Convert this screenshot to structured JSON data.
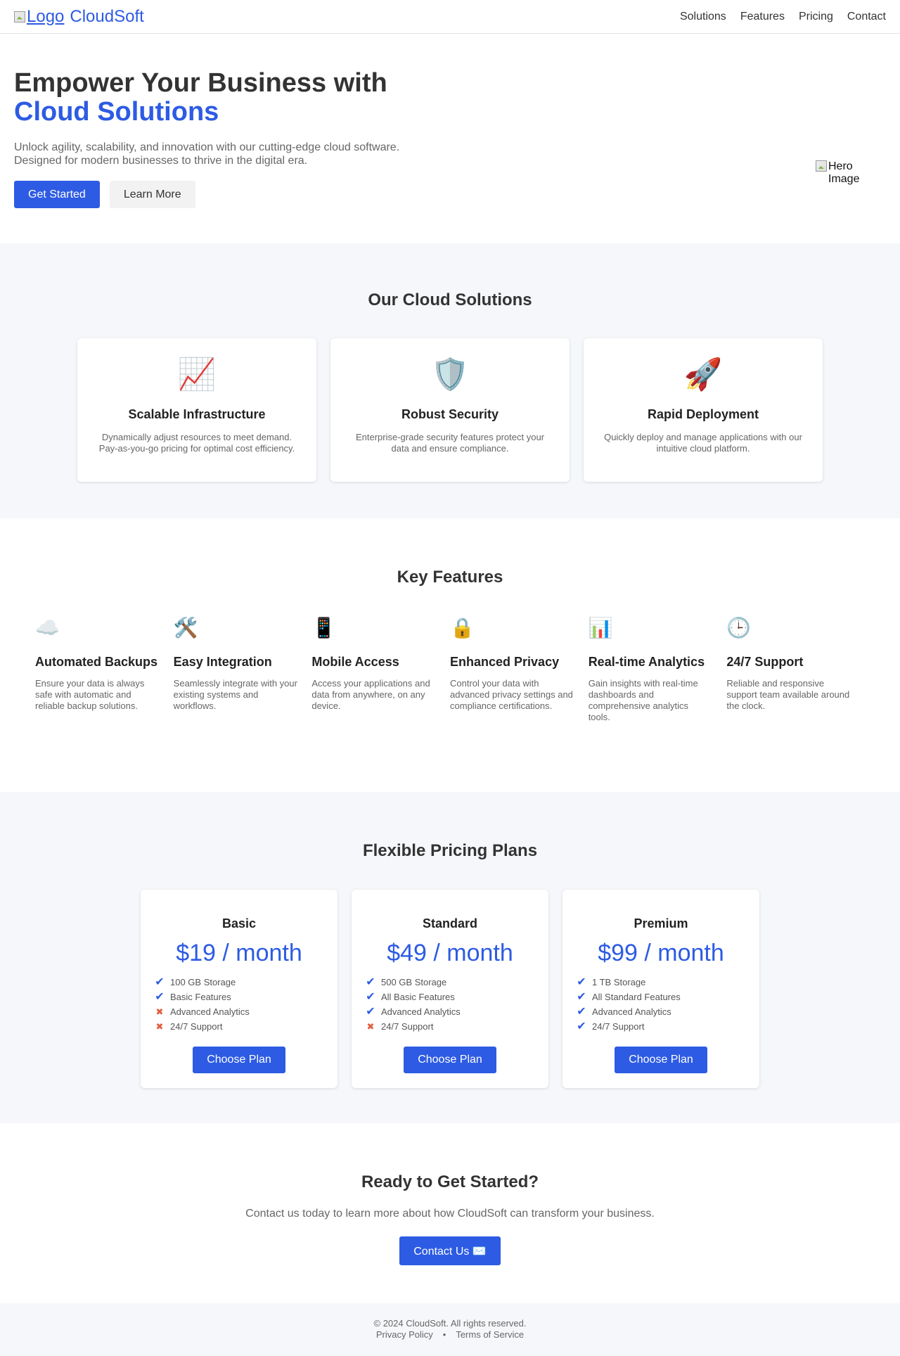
{
  "header": {
    "logo_alt": "Logo",
    "brand": "CloudSoft",
    "nav": [
      "Solutions",
      "Features",
      "Pricing",
      "Contact"
    ]
  },
  "hero": {
    "title_part1": "Empower Your Business with ",
    "title_accent": "Cloud Solutions",
    "subtitle_line1": "Unlock agility, scalability, and innovation with our cutting-edge cloud software.",
    "subtitle_line2": "Designed for modern businesses to thrive in the digital era.",
    "primary_button": "Get Started",
    "secondary_button": "Learn More",
    "image_alt": "Hero Image"
  },
  "solutions": {
    "title": "Our Cloud Solutions",
    "cards": [
      {
        "icon": "📈",
        "icon_name": "chart-increasing-icon",
        "title": "Scalable Infrastructure",
        "description": "Dynamically adjust resources to meet demand. Pay-as-you-go pricing for optimal cost efficiency."
      },
      {
        "icon": "🛡️",
        "icon_name": "shield-icon",
        "title": "Robust Security",
        "description": "Enterprise-grade security features protect your data and ensure compliance."
      },
      {
        "icon": "🚀",
        "icon_name": "rocket-icon",
        "title": "Rapid Deployment",
        "description": "Quickly deploy and manage applications with our intuitive cloud platform."
      }
    ]
  },
  "features": {
    "title": "Key Features",
    "items": [
      {
        "icon": "☁️",
        "icon_name": "cloud-icon",
        "title": "Automated Backups",
        "description": "Ensure your data is always safe with automatic and reliable backup solutions."
      },
      {
        "icon": "🛠️",
        "icon_name": "tools-icon",
        "title": "Easy Integration",
        "description": "Seamlessly integrate with your existing systems and workflows."
      },
      {
        "icon": "📱",
        "icon_name": "mobile-phone-icon",
        "title": "Mobile Access",
        "description": "Access your applications and data from anywhere, on any device."
      },
      {
        "icon": "🔒",
        "icon_name": "lock-icon",
        "title": "Enhanced Privacy",
        "description": "Control your data with advanced privacy settings and compliance certifications."
      },
      {
        "icon": "📊",
        "icon_name": "bar-chart-icon",
        "title": "Real-time Analytics",
        "description": "Gain insights with real-time dashboards and comprehensive analytics tools."
      },
      {
        "icon": "🕒",
        "icon_name": "clock-icon",
        "title": "24/7 Support",
        "description": "Reliable and responsive support team available around the clock."
      }
    ]
  },
  "pricing": {
    "title": "Flexible Pricing Plans",
    "check_icon": "✔",
    "cross_icon": "✖",
    "plans": [
      {
        "name": "Basic",
        "price": "$19 / month",
        "button": "Choose Plan",
        "features": [
          {
            "text": "100 GB Storage",
            "included": true
          },
          {
            "text": "Basic Features",
            "included": true
          },
          {
            "text": "Advanced Analytics",
            "included": false
          },
          {
            "text": "24/7 Support",
            "included": false
          }
        ]
      },
      {
        "name": "Standard",
        "price": "$49 / month",
        "button": "Choose Plan",
        "features": [
          {
            "text": "500 GB Storage",
            "included": true
          },
          {
            "text": "All Basic Features",
            "included": true
          },
          {
            "text": "Advanced Analytics",
            "included": true
          },
          {
            "text": "24/7 Support",
            "included": false
          }
        ]
      },
      {
        "name": "Premium",
        "price": "$99 / month",
        "button": "Choose Plan",
        "features": [
          {
            "text": "1 TB Storage",
            "included": true
          },
          {
            "text": "All Standard Features",
            "included": true
          },
          {
            "text": "Advanced Analytics",
            "included": true
          },
          {
            "text": "24/7 Support",
            "included": true
          }
        ]
      }
    ]
  },
  "cta": {
    "title": "Ready to Get Started?",
    "text": "Contact us today to learn more about how CloudSoft can transform your business.",
    "button": "Contact Us ✉️"
  },
  "footer": {
    "copyright": "© 2024 CloudSoft. All rights reserved.",
    "privacy": "Privacy Policy",
    "separator": "•",
    "terms": "Terms of Service"
  },
  "colors": {
    "accent": "#2d5be3",
    "section_bg": "#f5f7fa",
    "cross": "#e25c3c"
  }
}
